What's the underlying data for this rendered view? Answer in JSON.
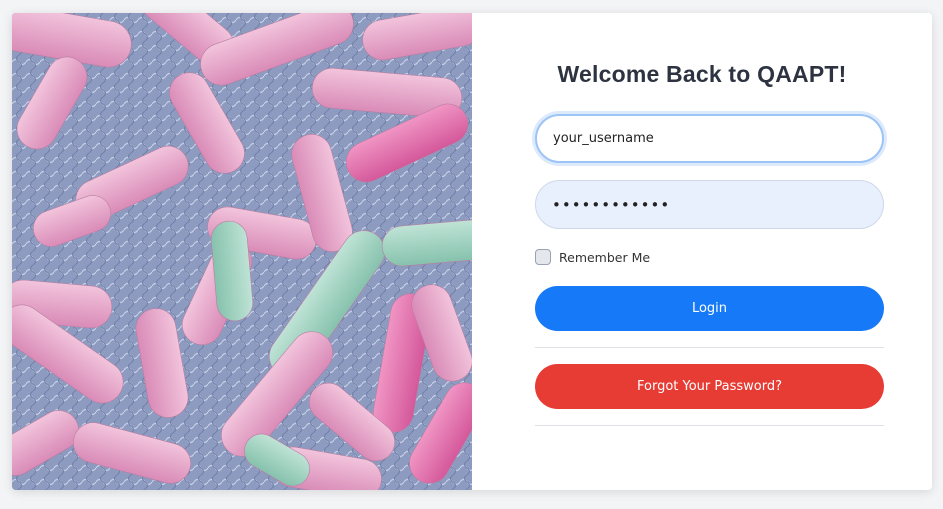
{
  "login": {
    "title": "Welcome Back to QAAPT!",
    "username_value": "your_username",
    "password_value": "••••••••••••",
    "remember_label": "Remember Me",
    "remember_checked": false,
    "login_label": "Login",
    "forgot_label": "Forgot Your Password?"
  },
  "colors": {
    "login_button": "#1679f7",
    "forgot_button": "#e73c34",
    "title": "#2d3340",
    "password_fill": "#e8f0fe"
  },
  "image": {
    "subject": "bacteria-micrograph-image"
  }
}
